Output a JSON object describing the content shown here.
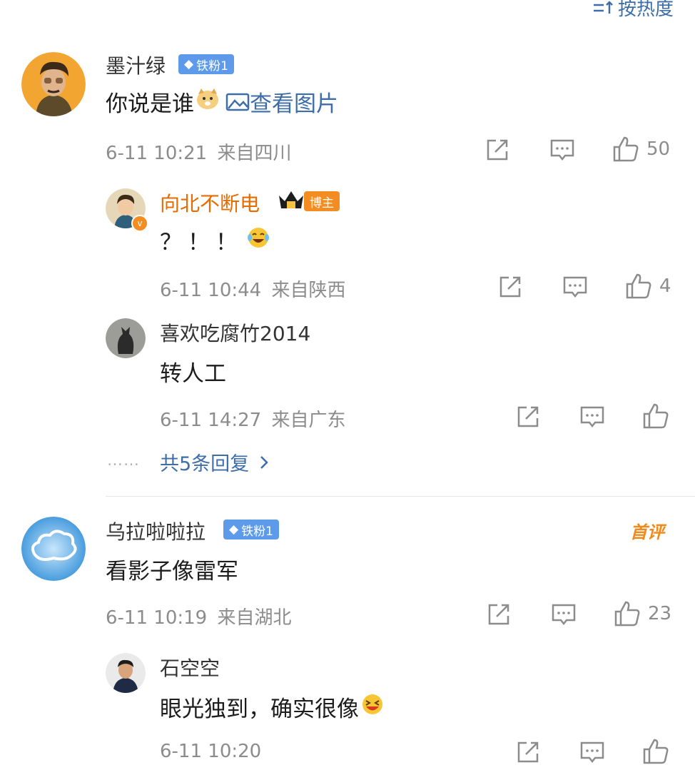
{
  "sort_label": "按热度",
  "comments": [
    {
      "user": "墨汁绿",
      "badge": "铁粉1",
      "text": "你说是谁",
      "image_link": "查看图片",
      "time": "6-11 10:21",
      "location": "来自四川",
      "likes": "50",
      "replies": [
        {
          "user": "向北不断电",
          "badge": "博主",
          "text": "？！！",
          "time": "6-11 10:44",
          "location": "来自陕西",
          "likes": "4"
        },
        {
          "user": "喜欢吃腐竹2014",
          "text": "转人工",
          "time": "6-11 14:27",
          "location": "来自广东",
          "likes": ""
        }
      ],
      "more_replies": "共5条回复"
    },
    {
      "user": "乌拉啦啦拉",
      "badge": "铁粉1",
      "tag": "首评",
      "text": "看影子像雷军",
      "time": "6-11 10:19",
      "location": "来自湖北",
      "likes": "23",
      "replies": [
        {
          "user": "石空空",
          "text": "眼光独到，确实很像",
          "time": "6-11 10:20",
          "likes": ""
        }
      ]
    }
  ],
  "colors": {
    "link": "#3d6ea8",
    "fan_badge": "#5d9bea",
    "blogger": "#e86b00",
    "meta": "#8c8c8c"
  }
}
